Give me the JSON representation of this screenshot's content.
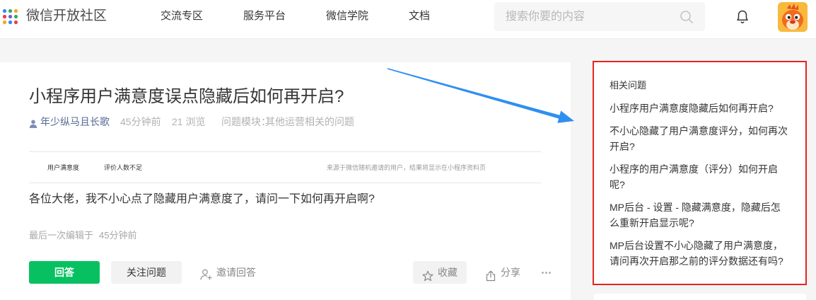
{
  "header": {
    "brand": "微信开放社区",
    "nav": [
      {
        "label": "交流专区"
      },
      {
        "label": "服务平台"
      },
      {
        "label": "微信学院"
      },
      {
        "label": "文档"
      }
    ],
    "search": {
      "placeholder": "搜索你要的内容"
    }
  },
  "question": {
    "title": "小程序用户满意度误点隐藏后如何再开启?",
    "author": "年少纵马且长歌",
    "posted": "45分钟前",
    "views": "21 浏览",
    "module_label": "问题模块：",
    "module": "其他运营相关的问题",
    "image": {
      "label": "用户满意度",
      "value": "评价人数不足",
      "note": "来源于微信随机邀请的用户，结果将显示在小程序资料页"
    },
    "body": "各位大佬，我不小心点了隐藏用户满意度了，请问一下如何再开启啊?",
    "edited_label": "最后一次编辑于",
    "edited_time": "45分钟前",
    "actions": {
      "answer": "回答",
      "follow": "关注问题",
      "invite": "邀请回答",
      "favorite": "收藏",
      "share": "分享"
    }
  },
  "sidebar": {
    "title": "相关问题",
    "items": [
      {
        "label": "小程序用户满意度隐藏后如何再开启?"
      },
      {
        "label": "不小心隐藏了用户满意度评分，如何再次开启?"
      },
      {
        "label": "小程序的用户满意度（评分）如何开启呢?"
      },
      {
        "label": "MP后台 - 设置 - 隐藏满意度，隐藏后怎么重新开启显示呢?"
      },
      {
        "label": "MP后台设置不小心隐藏了用户满意度，请问再次开启那之前的评分数据还有吗?"
      }
    ]
  },
  "icons": {
    "logo": "brand-logo-icon",
    "search": "search-icon",
    "notifications": "bell-icon",
    "author": "user-icon",
    "invite": "add-user-icon",
    "favorite": "star-icon",
    "share": "share-icon",
    "more": "more-icon"
  },
  "colors": {
    "brand_green": "#07c160",
    "link_blue": "#576b95",
    "text": "#353535",
    "muted": "#b2b2b2",
    "annotation_red": "#e8231f",
    "annotation_arrow": "#2f8ff0"
  }
}
